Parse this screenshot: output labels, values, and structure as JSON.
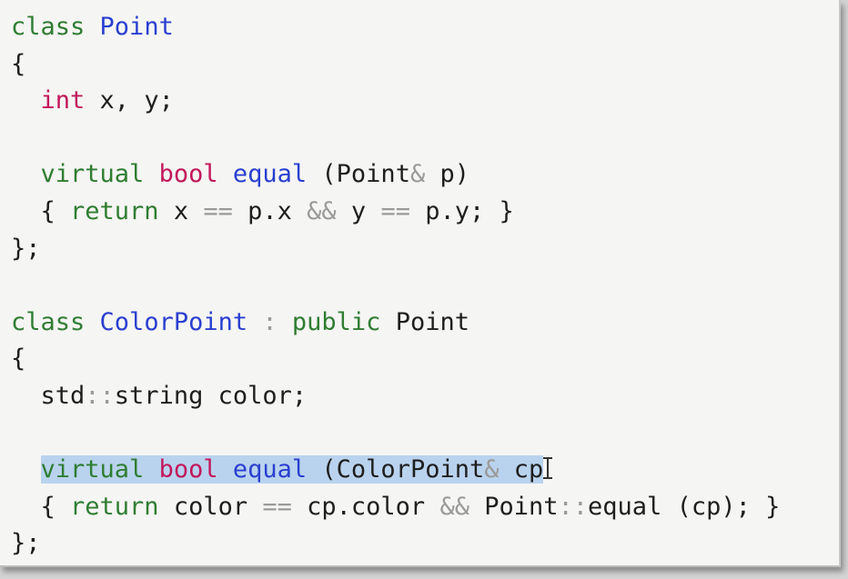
{
  "code": {
    "lines": [
      [
        {
          "t": "class",
          "c": "kw-green"
        },
        {
          "t": " "
        },
        {
          "t": "Point",
          "c": "cls"
        }
      ],
      [
        {
          "t": "{"
        }
      ],
      [
        {
          "t": "  "
        },
        {
          "t": "int",
          "c": "kw-red"
        },
        {
          "t": " x, y;"
        }
      ],
      [],
      [
        {
          "t": "  "
        },
        {
          "t": "virtual",
          "c": "kw-green"
        },
        {
          "t": " "
        },
        {
          "t": "bool",
          "c": "kw-red"
        },
        {
          "t": " "
        },
        {
          "t": "equal",
          "c": "cls"
        },
        {
          "t": " (Point"
        },
        {
          "t": "&",
          "c": "pun"
        },
        {
          "t": " p)"
        }
      ],
      [
        {
          "t": "  { "
        },
        {
          "t": "return",
          "c": "kw-green"
        },
        {
          "t": " x "
        },
        {
          "t": "==",
          "c": "pun"
        },
        {
          "t": " p.x "
        },
        {
          "t": "&&",
          "c": "pun"
        },
        {
          "t": " y "
        },
        {
          "t": "==",
          "c": "pun"
        },
        {
          "t": " p.y; }"
        }
      ],
      [
        {
          "t": "};"
        }
      ],
      [],
      [
        {
          "t": "class",
          "c": "kw-green"
        },
        {
          "t": " "
        },
        {
          "t": "ColorPoint",
          "c": "cls"
        },
        {
          "t": " "
        },
        {
          "t": ":",
          "c": "pun"
        },
        {
          "t": " "
        },
        {
          "t": "public",
          "c": "kw-green"
        },
        {
          "t": " Point"
        }
      ],
      [
        {
          "t": "{"
        }
      ],
      [
        {
          "t": "  std"
        },
        {
          "t": "::",
          "c": "pun"
        },
        {
          "t": "string color;"
        }
      ],
      [],
      [
        {
          "t": "  "
        },
        {
          "t": "virtual",
          "c": "kw-green",
          "h": true
        },
        {
          "t": " ",
          "h": true
        },
        {
          "t": "bool",
          "c": "kw-red",
          "h": true
        },
        {
          "t": " ",
          "h": true
        },
        {
          "t": "equal",
          "c": "cls",
          "h": true
        },
        {
          "t": " (ColorPoint",
          "h": true
        },
        {
          "t": "&",
          "c": "pun",
          "h": true
        },
        {
          "t": " cp",
          "h": true
        },
        {
          "cursor": true
        }
      ],
      [
        {
          "t": "  { "
        },
        {
          "t": "return",
          "c": "kw-green"
        },
        {
          "t": " color "
        },
        {
          "t": "==",
          "c": "pun"
        },
        {
          "t": " cp.color "
        },
        {
          "t": "&&",
          "c": "pun"
        },
        {
          "t": " Point"
        },
        {
          "t": "::",
          "c": "pun"
        },
        {
          "t": "equal (cp); }"
        }
      ],
      [
        {
          "t": "};"
        }
      ]
    ]
  }
}
